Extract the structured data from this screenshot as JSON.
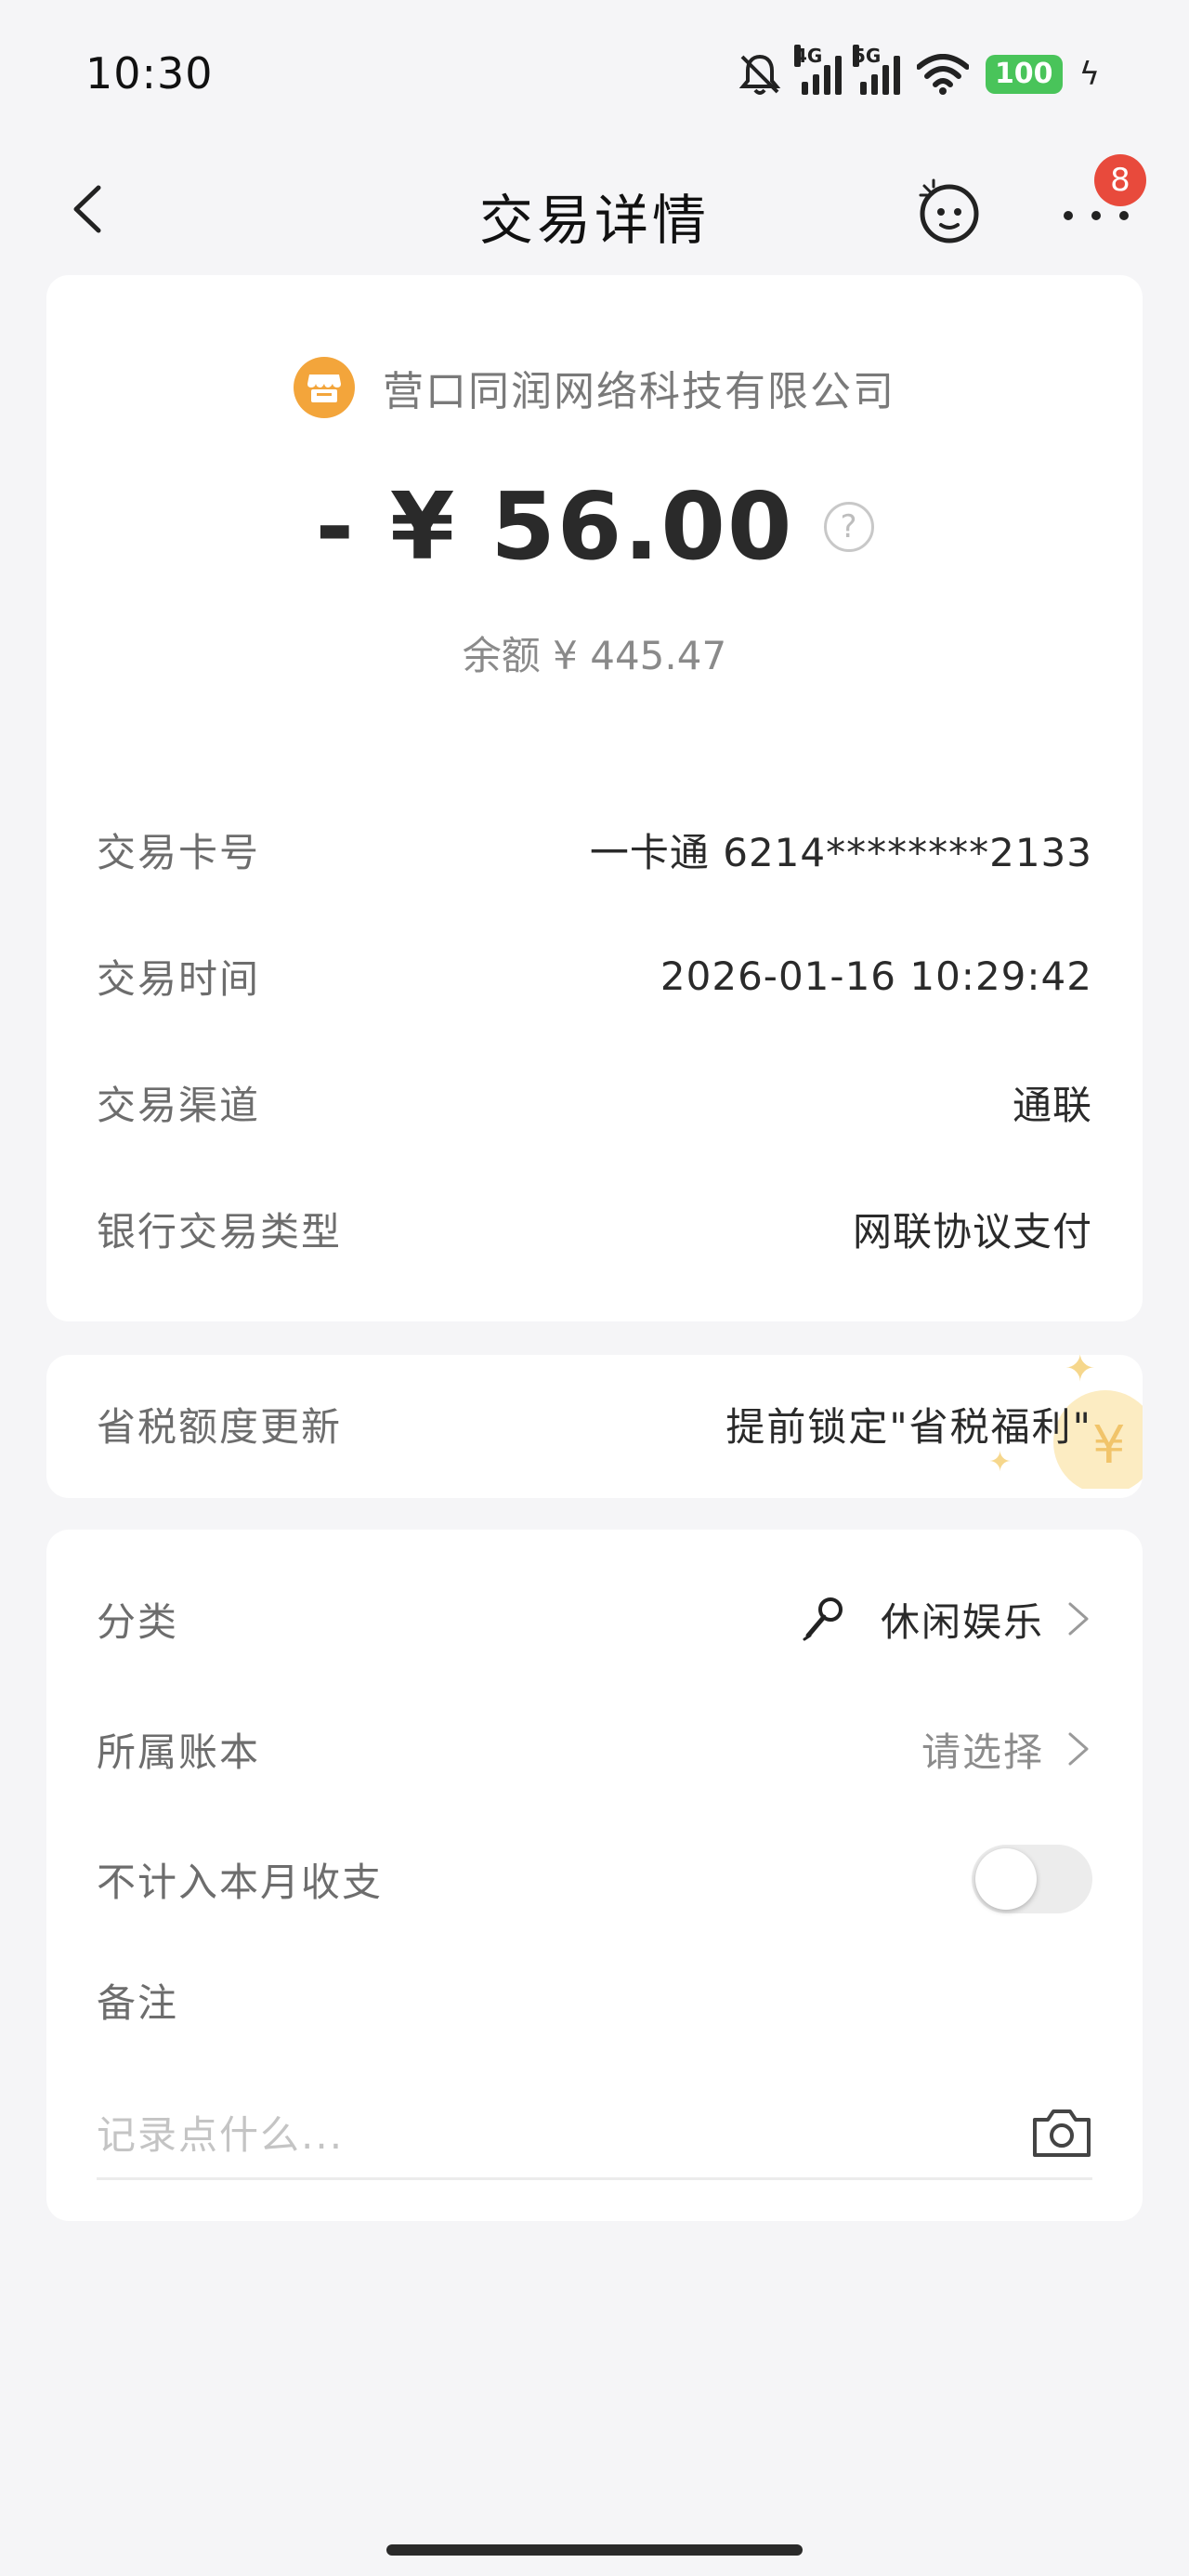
{
  "status_bar": {
    "time": "10:30",
    "net_4g": "4G",
    "net_5g": "5G",
    "battery": "100",
    "icons": [
      "mute-icon",
      "signal-4g-icon",
      "signal-5g-icon",
      "wifi-icon",
      "battery-icon",
      "charging-icon"
    ]
  },
  "nav": {
    "title": "交易详情",
    "more_badge": "8"
  },
  "transaction": {
    "merchant": "营口同润网络科技有限公司",
    "amount": "- ¥ 56.00",
    "help": "?",
    "balance": "余额 ¥ 445.47"
  },
  "details": [
    {
      "label": "交易卡号",
      "value": "一卡通 6214********2133"
    },
    {
      "label": "交易时间",
      "value": "2026-01-16 10:29:42"
    },
    {
      "label": "交易渠道",
      "value": "通联"
    },
    {
      "label": "银行交易类型",
      "value": "网联协议支付"
    }
  ],
  "tax": {
    "label": "省税额度更新",
    "value": "提前锁定\"省税福利\""
  },
  "settings": {
    "category_label": "分类",
    "category_value": "休闲娱乐",
    "ledger_label": "所属账本",
    "ledger_value": "请选择",
    "exclude_label": "不计入本月收支",
    "exclude_on": false,
    "note_label": "备注",
    "note_placeholder": "记录点什么..."
  },
  "colors": {
    "merchant_icon": "#f3a53b",
    "badge": "#e84a3c",
    "battery": "#49c45a"
  }
}
